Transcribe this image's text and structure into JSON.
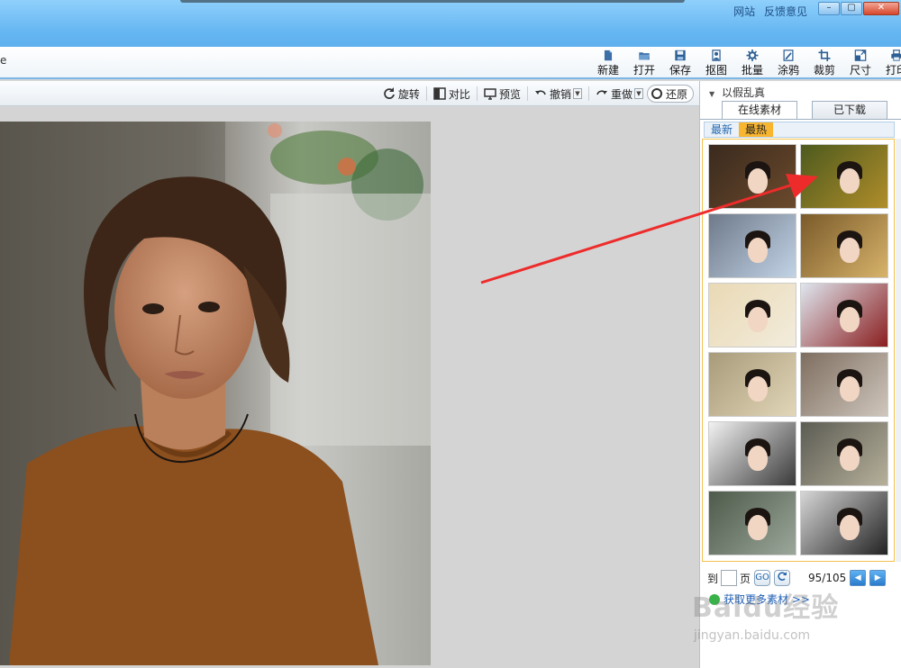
{
  "titlebar": {
    "links": [
      "网站",
      "反馈意见"
    ],
    "window_buttons": {
      "minimize": "–",
      "maximize": "▢",
      "close": "✕"
    }
  },
  "toolbar": {
    "left_fragment": "e",
    "tools": [
      {
        "label": "新建",
        "icon": "new-file-icon"
      },
      {
        "label": "打开",
        "icon": "open-folder-icon"
      },
      {
        "label": "保存",
        "icon": "save-icon"
      },
      {
        "label": "抠图",
        "icon": "cutout-icon"
      },
      {
        "label": "批量",
        "icon": "batch-icon"
      },
      {
        "label": "涂鸦",
        "icon": "doodle-icon"
      },
      {
        "label": "裁剪",
        "icon": "crop-icon"
      },
      {
        "label": "尺寸",
        "icon": "resize-icon"
      },
      {
        "label": "打印",
        "icon": "print-icon"
      }
    ]
  },
  "edit_toolbar": {
    "rotate": "旋转",
    "compare": "对比",
    "preview": "预览",
    "undo": "撤销",
    "redo": "重做",
    "restore": "还原"
  },
  "right_panel": {
    "section_title": "以假乱真",
    "tabs": [
      "在线素材",
      "已下载"
    ],
    "subtabs": [
      "最新",
      "最热"
    ],
    "active_subtab": 1,
    "pager": {
      "to_label": "到",
      "page_label": "页",
      "go": "GO",
      "page_count": "95/105",
      "prev": "◀",
      "next": "▶"
    },
    "more_link": "获取更多素材 >>"
  },
  "watermark": {
    "line1": "Baidu经验",
    "line2": "jingyan.baidu.com"
  },
  "colors": {
    "titlebar": "#64b6f2",
    "accent_orange": "#f7b530",
    "arrow_red": "#ee2b2b",
    "link_blue": "#1e5fb6"
  }
}
